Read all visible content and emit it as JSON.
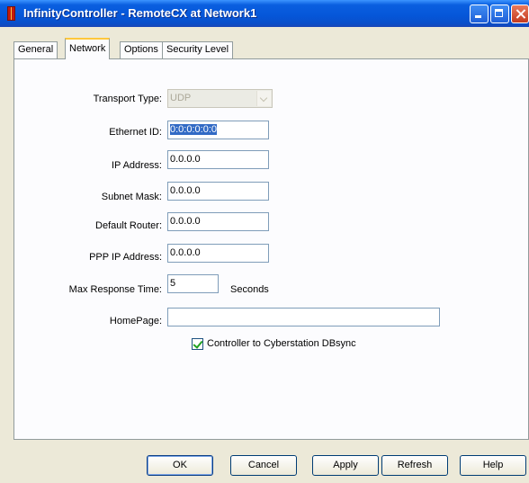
{
  "window": {
    "title": "InfinityController - RemoteCX at Network1",
    "buttons": [
      "minimize-icon",
      "maximize-icon",
      "close-icon"
    ]
  },
  "tabs": [
    {
      "label": "General",
      "active": false
    },
    {
      "label": "Network",
      "active": true
    },
    {
      "label": "Options",
      "active": false
    },
    {
      "label": "Security Level",
      "active": false
    }
  ],
  "form": {
    "transport_type": {
      "label": "Transport Type:",
      "value": "UDP",
      "enabled": false
    },
    "ethernet_id": {
      "label": "Ethernet ID:",
      "value": "0:0:0:0:0:0"
    },
    "ip_address": {
      "label": "IP Address:",
      "value": "0.0.0.0"
    },
    "subnet_mask": {
      "label": "Subnet Mask:",
      "value": "0.0.0.0"
    },
    "default_router": {
      "label": "Default Router:",
      "value": "0.0.0.0"
    },
    "ppp_ip_address": {
      "label": "PPP IP Address:",
      "value": "0.0.0.0"
    },
    "max_response_time": {
      "label": "Max Response Time:",
      "value": "5",
      "unit": "Seconds"
    },
    "homepage": {
      "label": "HomePage:",
      "value": ""
    },
    "dbsync": {
      "label": "Controller to Cyberstation DBsync",
      "checked": true
    }
  },
  "buttons": {
    "ok": "OK",
    "cancel": "Cancel",
    "apply": "Apply",
    "refresh": "Refresh",
    "help": "Help"
  },
  "colors": {
    "titlebar": "#0556d8",
    "dialog_bg": "#ece9d8",
    "tab_highlight": "#ffc83c",
    "selection": "#316ac5"
  }
}
